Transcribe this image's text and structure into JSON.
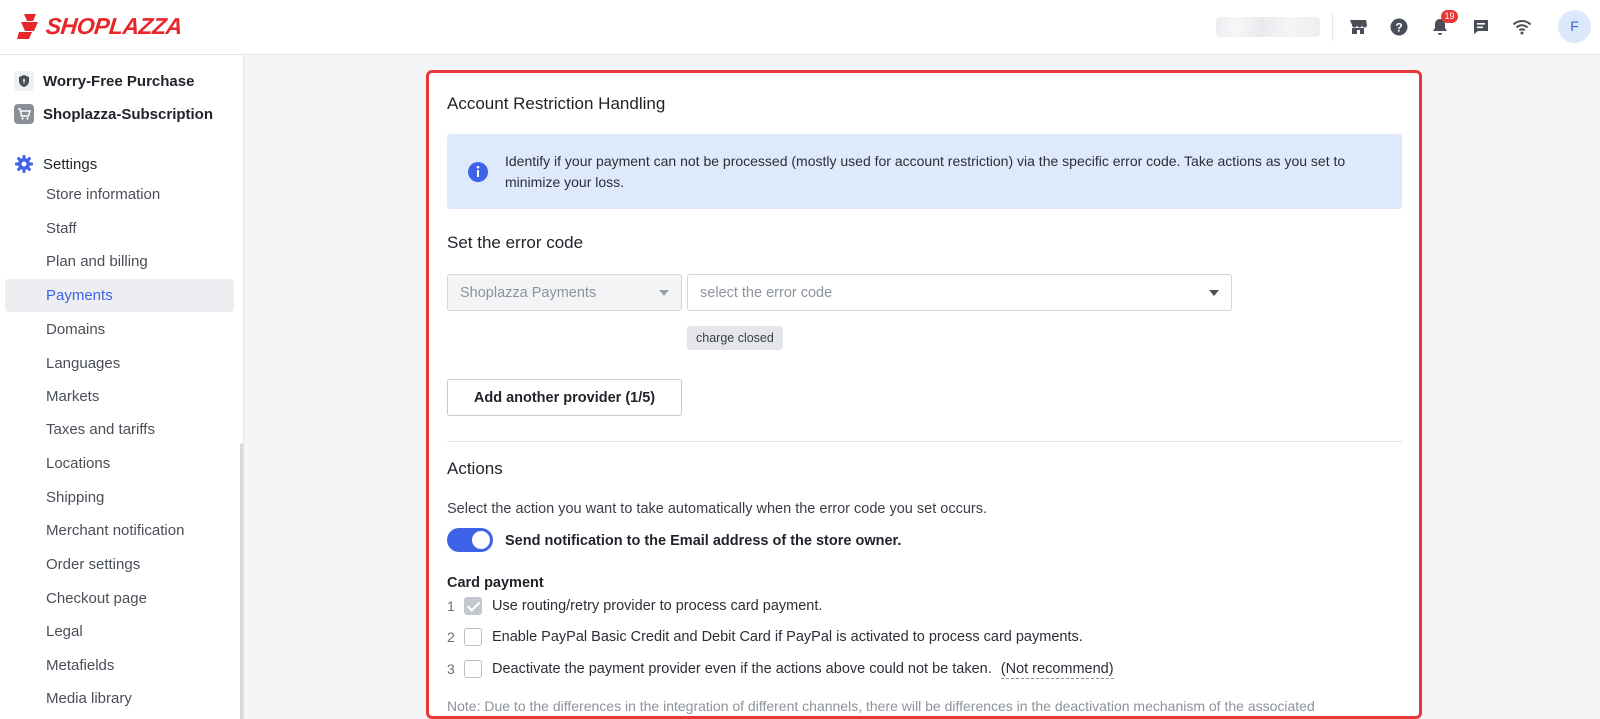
{
  "brand": {
    "name": "SHOPLAZZA",
    "accent": "#e8262a",
    "primary": "#3f63e8"
  },
  "header": {
    "icons": [
      "store-icon",
      "help-icon",
      "bell-icon",
      "chat-icon",
      "wifi-icon"
    ],
    "notification_count": "19",
    "avatar_initial": "F"
  },
  "sidebar": {
    "apps": [
      {
        "label": "Worry-Free Purchase",
        "icon": "shield-icon"
      },
      {
        "label": "Shoplazza-Subscription",
        "icon": "subscription-cart-icon"
      }
    ],
    "settings_label": "Settings",
    "items": [
      {
        "label": "Store information"
      },
      {
        "label": "Staff"
      },
      {
        "label": "Plan and billing"
      },
      {
        "label": "Payments",
        "active": true
      },
      {
        "label": "Domains"
      },
      {
        "label": "Languages"
      },
      {
        "label": "Markets"
      },
      {
        "label": "Taxes and tariffs"
      },
      {
        "label": "Locations"
      },
      {
        "label": "Shipping"
      },
      {
        "label": "Merchant notification"
      },
      {
        "label": "Order settings"
      },
      {
        "label": "Checkout page"
      },
      {
        "label": "Legal"
      },
      {
        "label": "Metafields"
      },
      {
        "label": "Media library"
      }
    ]
  },
  "main": {
    "title": "Account Restriction Handling",
    "info": "Identify if your payment can not be processed (mostly used for account restriction) via the specific error code. Take actions as you set to minimize your loss.",
    "error_code_title": "Set the error code",
    "provider_select": "Shoplazza Payments",
    "error_code_placeholder": "select the error code",
    "selected_codes": [
      "charge closed"
    ],
    "add_provider_button": "Add another provider (1/5)",
    "actions_title": "Actions",
    "actions_desc": "Select the action you want to take automatically when the error code you set occurs.",
    "notify_toggle": {
      "label": "Send notification to the Email address of the store owner.",
      "on": true
    },
    "card_payment_title": "Card payment",
    "card_options": [
      {
        "num": "1",
        "label": "Use routing/retry provider to process card payment.",
        "checked": true
      },
      {
        "num": "2",
        "label": "Enable PayPal Basic Credit and Debit Card if PayPal is activated to process card payments.",
        "checked": false
      },
      {
        "num": "3",
        "label": "Deactivate the payment provider even if the actions above could not be taken.",
        "checked": false,
        "suffix": "(Not recommend)"
      }
    ],
    "note": "Note: Due to the differences in the integration of different channels, there will be differences in the deactivation mechanism of the associated"
  }
}
